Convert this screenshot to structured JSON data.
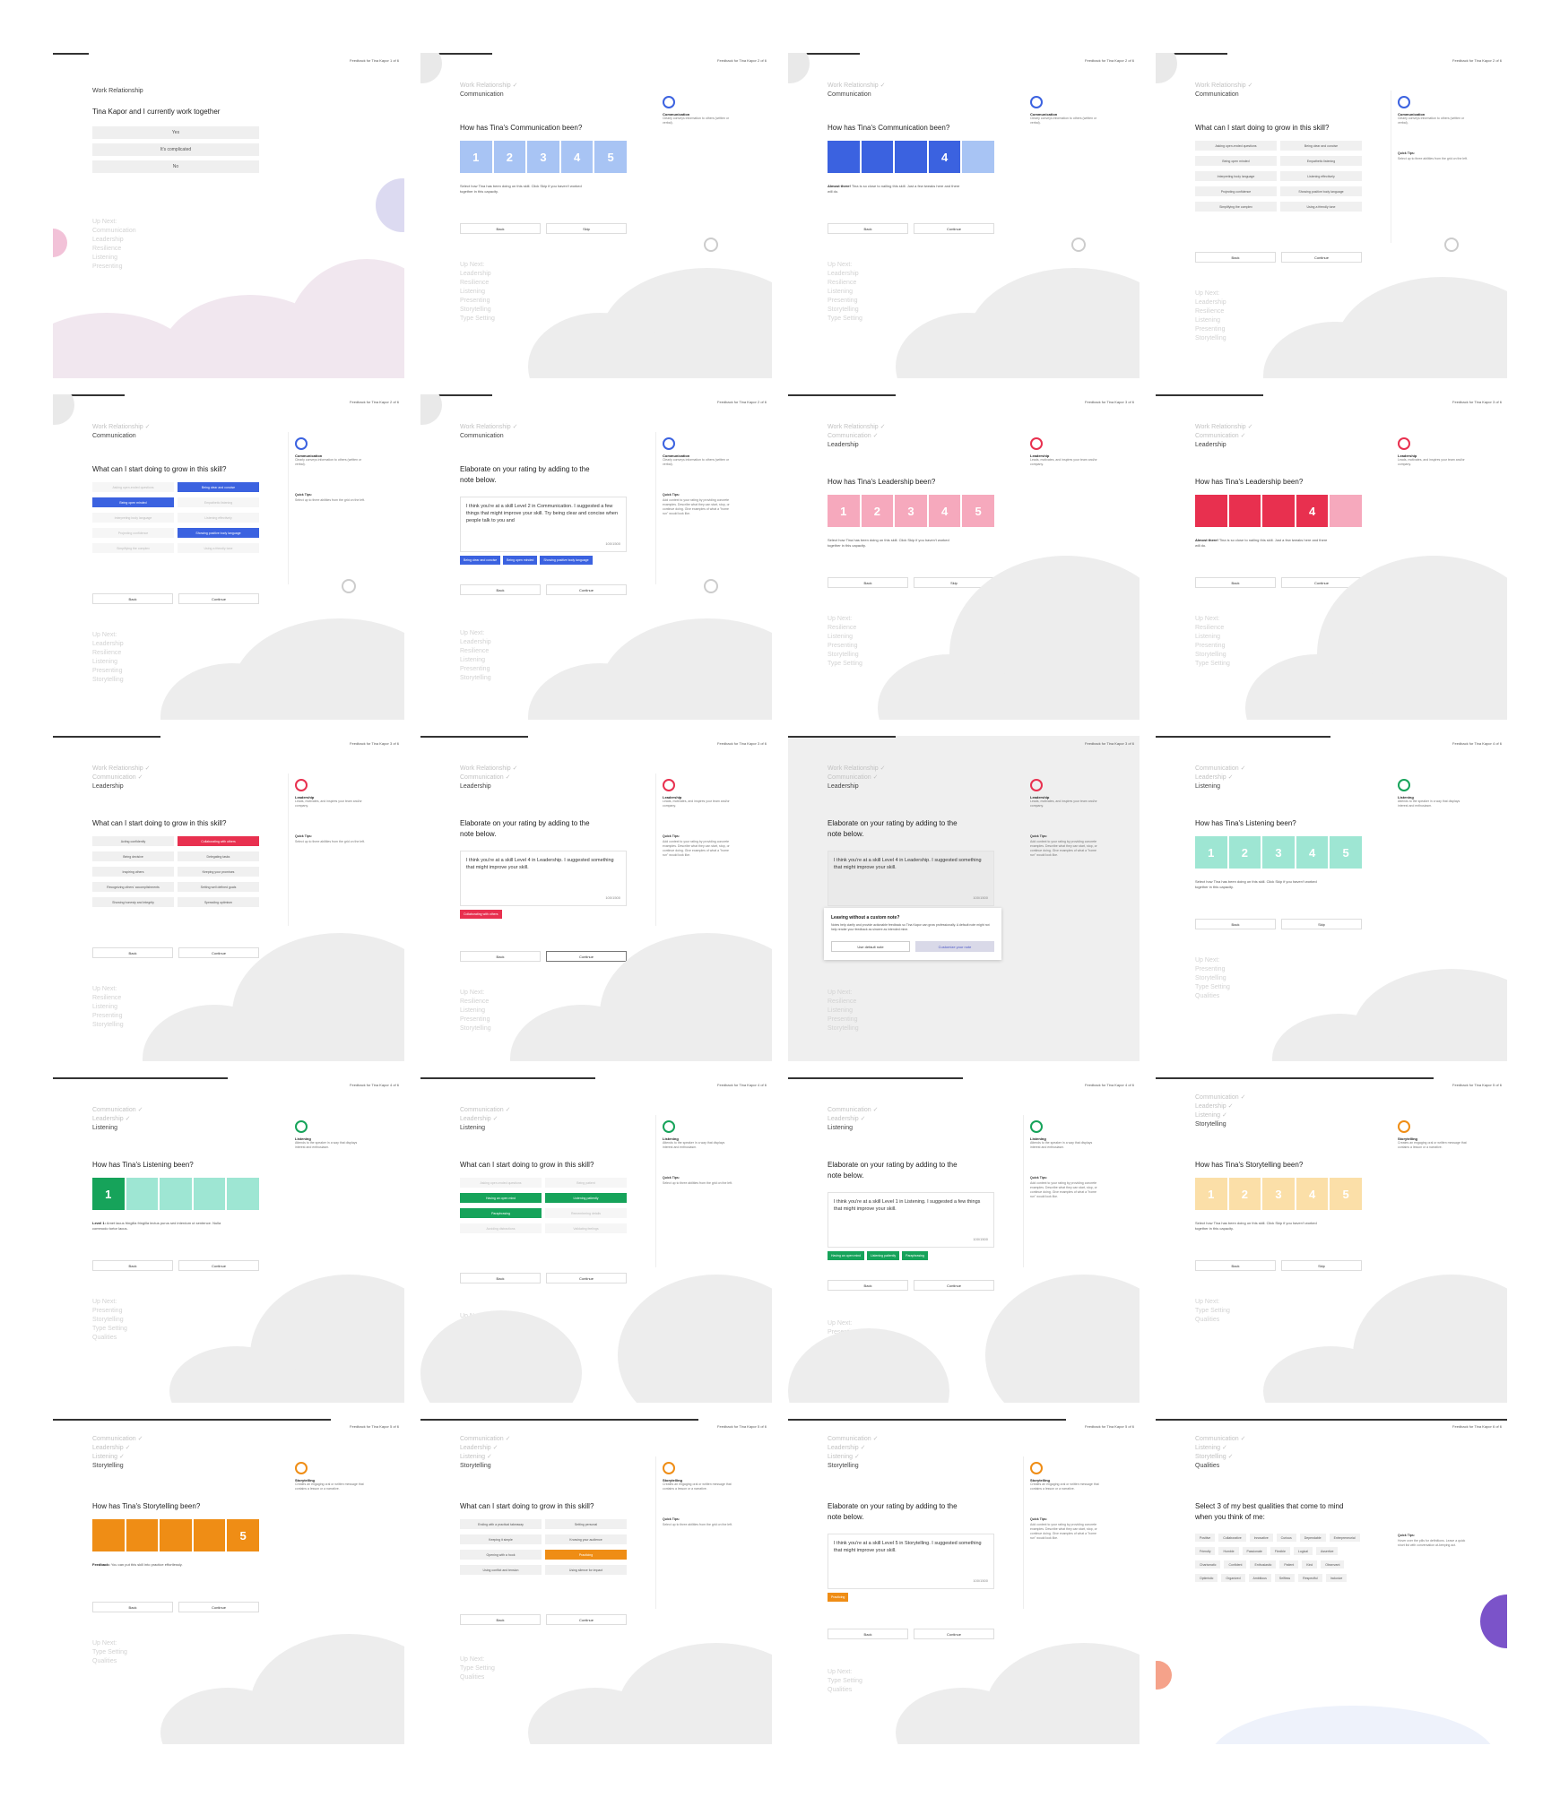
{
  "page_header": "Feedback for Tina Kapor",
  "step_labels": [
    "1 of 6",
    "2 of 6",
    "2 of 6",
    "2 of 6",
    "2 of 6",
    "2 of 6",
    "3 of 6",
    "3 of 6",
    "3 of 6",
    "3 of 6",
    "3 of 6",
    "4 of 6",
    "4 of 6",
    "4 of 6",
    "4 of 6",
    "5 of 6",
    "5 of 6",
    "5 of 6",
    "5 of 6",
    "6 of 6"
  ],
  "common": {
    "back": "Back",
    "continue": "Continue",
    "skip": "Skip",
    "up_next": "Up Next:",
    "quick_tips": "Quick Tips:",
    "grow_question": "What can I start doing to grow in this skill?",
    "elaborate_question": "Elaborate on your rating by adding to the note below.",
    "select_help": "Select how Tina has been doing on this skill. Click Skip if you haven't worked together in this capacity.",
    "tip_grow": "Select up to three abilities from the grid on the left.",
    "tip_note": "Add context to your rating by providing concrete examples. Describe what they can start, stop, or continue doing. Give examples of what a \"home run\" would look like.",
    "char_count": "100/1500"
  },
  "skills": {
    "communication": {
      "name": "Communication",
      "desc": "Clearly conveys information to others (written or verbal).",
      "color": "#3b62e0",
      "light": "#a8c4f4"
    },
    "leadership": {
      "name": "Leadership",
      "desc": "Leads, motivates, and inspires your team and/or company.",
      "color": "#e8304f",
      "light": "#f6a9bd"
    },
    "listening": {
      "name": "Listening",
      "desc": "Attends to the speaker in a way that displays interest and enthusiasm.",
      "color": "#16a35a",
      "light": "#9ee6d3"
    },
    "storytelling": {
      "name": "Storytelling",
      "desc": "Creates an engaging oral or written message that contains a lesson or a narrative.",
      "color": "#ef8d15",
      "light": "#fbdfa8"
    }
  },
  "panels": {
    "p1": {
      "section": "Work Relationship",
      "question": "Tina Kapor and I currently work together",
      "options": [
        "Yes",
        "It's complicated",
        "No"
      ],
      "upnext": [
        "Communication",
        "Leadership",
        "Resilience",
        "Listening",
        "Presenting",
        "Storytelling"
      ]
    },
    "p2": {
      "crumbs": [
        "Work Relationship ✓",
        "Communication"
      ],
      "question": "How has Tina's Communication been?",
      "ratings": [
        "1",
        "2",
        "3",
        "4",
        "5"
      ],
      "upnext": [
        "Leadership",
        "Resilience",
        "Listening",
        "Presenting",
        "Storytelling",
        "Type Setting"
      ]
    },
    "p3": {
      "crumbs": [
        "Work Relationship ✓",
        "Communication"
      ],
      "question": "How has Tina's Communication been?",
      "rating": "4",
      "hint_bold": "Almost there!",
      "hint": " Tina is so close to nailing this skill. Just a few tweaks here and there will do.",
      "upnext": [
        "Leadership",
        "Resilience",
        "Listening",
        "Presenting",
        "Storytelling",
        "Type Setting"
      ]
    },
    "p4": {
      "crumbs": [
        "Work Relationship ✓",
        "Communication"
      ],
      "chips": [
        "Asking open-ended questions",
        "Being clear and concise",
        "Being open minded",
        "Empathetic listening",
        "Interpreting body language",
        "Listening effectively",
        "Projecting confidence",
        "Showing positive body language",
        "Simplifying the complex",
        "Using a friendly tone"
      ],
      "upnext": [
        "Leadership",
        "Resilience",
        "Listening",
        "Presenting",
        "Storytelling"
      ]
    },
    "p5": {
      "crumbs": [
        "Work Relationship ✓",
        "Communication"
      ],
      "upnext": [
        "Leadership",
        "Resilience",
        "Listening",
        "Presenting",
        "Storytelling"
      ]
    },
    "p6": {
      "crumbs": [
        "Work Relationship ✓",
        "Communication"
      ],
      "note": "I think you're at a skill Level 2 in Communication. I suggested a few things that might improve your skill. Try being clear and concise when people talk to you and",
      "tags": [
        "Being clear and concise",
        "Being open minded",
        "Showing positive body language"
      ],
      "upnext": [
        "Leadership",
        "Resilience",
        "Listening",
        "Presenting",
        "Storytelling"
      ]
    },
    "p7": {
      "crumbs": [
        "Work Relationship ✓",
        "Communication ✓",
        "Leadership"
      ],
      "question": "How has Tina's Leadership been?",
      "upnext": [
        "Resilience",
        "Listening",
        "Presenting",
        "Storytelling",
        "Type Setting"
      ]
    },
    "p8": {
      "crumbs": [
        "Work Relationship ✓",
        "Communication ✓",
        "Leadership"
      ],
      "question": "How has Tina's Leadership been?",
      "rating": "4",
      "hint_bold": "Almost there!",
      "hint": " Tina is so close to nailing this skill. Just a few tweaks here and there will do.",
      "upnext": [
        "Resilience",
        "Listening",
        "Presenting",
        "Storytelling",
        "Type Setting"
      ]
    },
    "p9": {
      "crumbs": [
        "Work Relationship ✓",
        "Communication ✓",
        "Leadership"
      ],
      "chips": [
        "Acting confidently",
        "Collaborating with others",
        "Being decisive",
        "Delegating tasks",
        "Inspiring others",
        "Keeping your promises",
        "Recognizing others' accomplishments",
        "Setting well defined goals",
        "Showing honesty and integrity",
        "Spreading optimism"
      ],
      "upnext": [
        "Resilience",
        "Listening",
        "Presenting",
        "Storytelling"
      ]
    },
    "p10": {
      "crumbs": [
        "Work Relationship ✓",
        "Communication ✓",
        "Leadership"
      ],
      "note": "I think you're at a skill Level 4 in Leadership. I suggested something that might improve your skill.",
      "tags": [
        "Collaborating with others"
      ],
      "upnext": [
        "Resilience",
        "Listening",
        "Presenting",
        "Storytelling"
      ]
    },
    "p11": {
      "crumbs": [
        "Work Relationship ✓",
        "Communication ✓",
        "Leadership"
      ],
      "note": "I think you're at a skill Level 4 in Leadership. I suggested something that might improve your skill.",
      "modal_title": "Leaving without a custom note?",
      "modal_text": "Notes help clarify and provide actionable feedback so Tina Kapor can grow professionally. A default note might not help render your feedback as sincere as intended mine.",
      "modal_default": "Use default note",
      "modal_custom": "Customize your note",
      "upnext": [
        "Resilience",
        "Listening",
        "Presenting",
        "Storytelling"
      ]
    },
    "p12": {
      "crumbs": [
        "Communication ✓",
        "Leadership ✓",
        "Listening"
      ],
      "question": "How has Tina's Listening been?",
      "upnext": [
        "Presenting",
        "Storytelling",
        "Type Setting",
        "Qualities"
      ]
    },
    "p13": {
      "crumbs": [
        "Communication ✓",
        "Leadership ✓",
        "Listening"
      ],
      "question": "How has Tina's Listening been?",
      "rating": "1",
      "hint_bold": "Level 1:",
      "hint": " Amet lacus fringilla fringilla lectus purus sed interdum ut sentence. Nulla commodo tortor lacus."
    },
    "p14": {
      "crumbs": [
        "Communication ✓",
        "Leadership ✓",
        "Listening"
      ],
      "chips": [
        "Asking open-ended questions",
        "Being patient",
        "Having an open mind",
        "Listening patiently",
        "Paraphrasing",
        "Remembering details",
        "Avoiding distractions",
        "Validating feelings"
      ],
      "upnext": [
        "Presenting",
        "Storytelling",
        "Type Setting"
      ]
    },
    "p15": {
      "crumbs": [
        "Communication ✓",
        "Leadership ✓",
        "Listening"
      ],
      "note": "I think you're at a skill Level 1 in Listening. I suggested a few things that might improve your skill.",
      "tags": [
        "Having an open mind",
        "Listening patiently",
        "Paraphrasing"
      ],
      "upnext": [
        "Presenting",
        "Storytelling",
        "Type Setting",
        "Qualities"
      ]
    },
    "p16": {
      "crumbs": [
        "Communication ✓",
        "Leadership ✓",
        "Listening ✓",
        "Storytelling"
      ],
      "question": "How has Tina's Storytelling been?",
      "upnext": [
        "Type Setting",
        "Qualities"
      ]
    },
    "p17": {
      "crumbs": [
        "Communication ✓",
        "Leadership ✓",
        "Listening ✓",
        "Storytelling"
      ],
      "question": "How has Tina's Storytelling been?",
      "rating": "5",
      "hint_bold": "Feedback:",
      "hint": " You can put this skill into practice effortlessly.",
      "upnext": [
        "Type Setting",
        "Qualities"
      ]
    },
    "p18": {
      "crumbs": [
        "Communication ✓",
        "Leadership ✓",
        "Listening ✓",
        "Storytelling"
      ],
      "chips": [
        "Ending with a practical takeaway",
        "Setting personal",
        "Keeping it simple",
        "Knowing your audience",
        "Opening with a hook",
        "Practicing",
        "Using conflict and tension",
        "Using silence for impact"
      ],
      "upnext": [
        "Type Setting",
        "Qualities"
      ]
    },
    "p19": {
      "crumbs": [
        "Communication ✓",
        "Leadership ✓",
        "Listening ✓",
        "Storytelling"
      ],
      "note": "I think you're at a skill Level 5 in Storytelling. I suggested something that might improve your skill.",
      "tags": [
        "Practicing"
      ],
      "upnext": [
        "Type Setting",
        "Qualities"
      ]
    },
    "p20": {
      "crumbs": [
        "Communication ✓",
        "Listening ✓",
        "Storytelling ✓",
        "Qualities"
      ],
      "question": "Select 3 of my best qualities that come to mind when you think of me:",
      "qualities": [
        "Positive",
        "Collaborative",
        "Innovative",
        "Curious",
        "Dependable",
        "Entrepreneurial",
        "Friendly",
        "Humble",
        "Passionate",
        "Flexible",
        "Logical",
        "Assertive",
        "Charismatic",
        "Confident",
        "Enthusiastic",
        "Patient",
        "Kind",
        "Observant",
        "Optimistic",
        "Organized",
        "Ambitious",
        "Selfless",
        "Respectful",
        "Inclusive"
      ],
      "tip": "Hover over the pills for definitions. Leave a quick short list with conversation at-keeping act."
    }
  }
}
